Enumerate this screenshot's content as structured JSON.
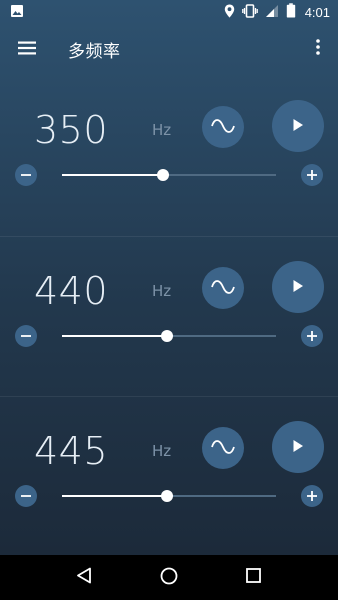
{
  "status_bar": {
    "time": "4:01",
    "icons": [
      "image-icon",
      "location-icon",
      "vibrate-icon",
      "signal-icon",
      "battery-icon"
    ]
  },
  "app_bar": {
    "title": "多频率",
    "icons": [
      "menu-icon",
      "more-vert-icon"
    ]
  },
  "tones": [
    {
      "frequency": "350",
      "unit": "Hz",
      "slider_fraction": 0.47
    },
    {
      "frequency": "440",
      "unit": "Hz",
      "slider_fraction": 0.49
    },
    {
      "frequency": "445",
      "unit": "Hz",
      "slider_fraction": 0.49
    }
  ],
  "colors": {
    "accent_button": "#3c6489",
    "background_top": "#2e5270",
    "background_bottom": "#1c2a3a"
  },
  "nav_bar": {
    "icons": [
      "back-icon",
      "home-icon",
      "recents-icon"
    ]
  }
}
